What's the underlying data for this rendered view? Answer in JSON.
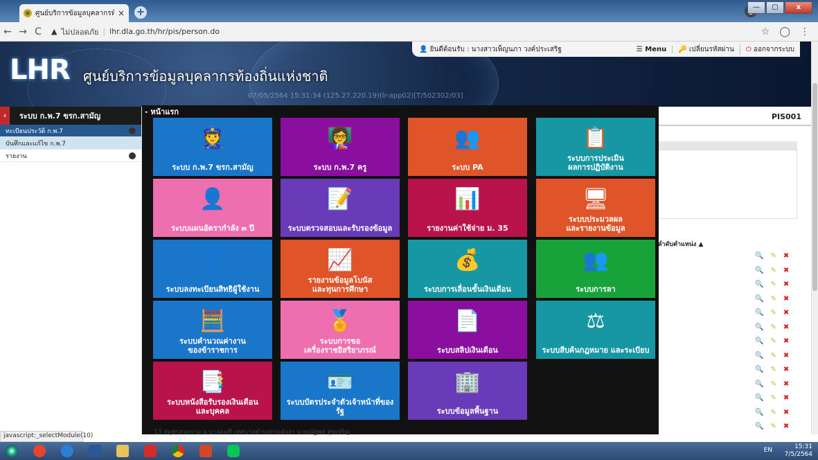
{
  "browser": {
    "tab_title": "ศูนย์บริการข้อมูลบุคลากรท้องถิ่นแห่",
    "tab_close": "×",
    "new_tab": "+",
    "security_label": "ไม่ปลอดภัย",
    "url": "lhr.dla.go.th/hr/pis/person.do",
    "window_buttons": [
      "—",
      "▢",
      "x"
    ]
  },
  "header": {
    "logo": "LHR",
    "site_name": "ศูนย์บริการข้อมูลบุคลากรท้องถิ่นแห่งชาติ",
    "ip_line": "07/05/2564 15:31:34 (125.27.220.19)(lr-app02)[T/502302/03]",
    "welcome": "ยินดีต้อนรับ : นางสาวเพ็ญนภา วงค์ประเสริฐ",
    "menu": "Menu",
    "change_password": "เปลี่ยนรหัสผ่าน",
    "logout": "ออกจากระบบ"
  },
  "sidebar": {
    "title": "ระบบ ก.พ.7 ขรก.สามัญ",
    "items": [
      {
        "label": "ทะเบียนประวัติ ก.พ.7"
      },
      {
        "label": "บันทึกและแก้ไข ก.พ.7"
      },
      {
        "label": "รายงาน"
      }
    ]
  },
  "main": {
    "code": "PIS001",
    "under_header": "ลำดับตำแหน่ง ▲"
  },
  "overlay": {
    "title": "- หน้าแรก",
    "tiles": [
      {
        "label": "ระบบ ก.พ.7 ขรก.สามัญ",
        "icon": "👮",
        "icon_name": "officer-icon",
        "color": "#1976c8"
      },
      {
        "label": "ระบบ ก.พ.7 ครู",
        "icon": "👩‍🏫",
        "icon_name": "classroom-icon",
        "color": "#8a0f9e"
      },
      {
        "label": "ระบบ PA",
        "icon": "👥",
        "icon_name": "people-group-icon",
        "color": "#e0542a"
      },
      {
        "label": "ระบบการประเมิน\nผลการปฏิบัติงาน",
        "icon": "📋",
        "icon_name": "checklist-icon",
        "color": "#1796a4"
      },
      {
        "label": "ระบบแผนอัตรากำลัง ๓ ปี",
        "icon": "👤",
        "icon_name": "org-chart-icon",
        "color": "#ee6fb0"
      },
      {
        "label": "ระบบตรวจสอบและรับรองข้อมูล",
        "icon": "📝",
        "icon_name": "document-check-icon",
        "color": "#6a3bb8"
      },
      {
        "label": "รายงานค่าใช้จ่าย ม. 35",
        "icon": "📊",
        "icon_name": "money-chart-icon",
        "color": "#b8134a"
      },
      {
        "label": "ระบบประมวลผล\nและรายงานข้อมูล",
        "icon": "🖥",
        "icon_name": "monitor-icon",
        "color": "#e0542a"
      },
      {
        "label": "ระบบลงทะเบียนสิทธิผู้ใช้งาน",
        "icon": "👤",
        "icon_name": "add-user-icon",
        "color": "#1976c8"
      },
      {
        "label": "รายงานข้อมูลโบนัส\nและทุนการศึกษา",
        "icon": "📈",
        "icon_name": "bonus-chart-icon",
        "color": "#e0542a"
      },
      {
        "label": "ระบบการเลื่อนขั้นเงินเดือน",
        "icon": "💰",
        "icon_name": "coins-icon",
        "color": "#1796a4"
      },
      {
        "label": "ระบบการลา",
        "icon": "👥",
        "icon_name": "leave-people-icon",
        "color": "#17a23a"
      },
      {
        "label": "ระบบคำนวณค่างาน\nของข้าราชการ",
        "icon": "🧮",
        "icon_name": "calculator-icon",
        "color": "#1976c8"
      },
      {
        "label": "ระบบการขอ\nเครื่องราชอิสริยาภรณ์",
        "icon": "🏅",
        "icon_name": "medal-icon",
        "color": "#ee6fb0"
      },
      {
        "label": "ระบบสลิปเงินเดือน",
        "icon": "📄",
        "icon_name": "payslip-icon",
        "color": "#8a0f9e"
      },
      {
        "label": "ระบบสืบค้นกฎหมาย และระเบียบ",
        "icon": "⚖",
        "icon_name": "scales-icon",
        "color": "#1796a4"
      },
      {
        "label": "ระบบหนังสือรับรองเงินเดือน\nและบุคคล",
        "icon": "📑",
        "icon_name": "certificate-icon",
        "color": "#b8134a"
      },
      {
        "label": "ระบบบัตรประจำตัวเจ้าหน้าที่ของรัฐ",
        "icon": "🪪",
        "icon_name": "id-card-icon",
        "color": "#1976c8"
      },
      {
        "label": "ระบบข้อมูลพื้นฐาน",
        "icon": "🏢",
        "icon_name": "hierarchy-icon",
        "color": "#6a3bb8"
      }
    ]
  },
  "status_text": "javascript:_selectModule(10)",
  "peek_row": "13  สมุทรสงคราม     อ.บางคนที     เทศบาลตำบลกระดังงา     นายณัฐพล สุขเจริญ",
  "taskbar": {
    "lang": "EN",
    "time": "15:31",
    "date": "7/5/2564"
  }
}
